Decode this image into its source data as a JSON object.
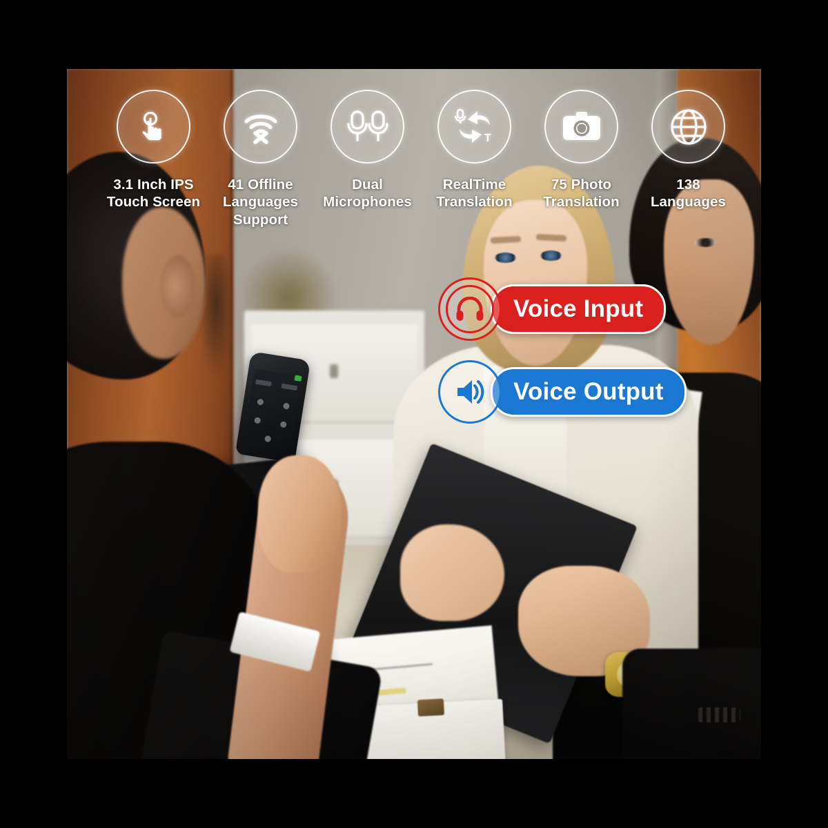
{
  "photo": {
    "scene_description": "Business meeting at a table with a woman holding a handheld voice translator device, another woman in a white blazer and a man in a black suit across the table",
    "frame_color": "#000000"
  },
  "features": [
    {
      "icon": "touch-screen-icon",
      "label": "3.1 Inch IPS\nTouch Screen"
    },
    {
      "icon": "wifi-offline-icon",
      "label": "41 Offline\nLanguages Support"
    },
    {
      "icon": "dual-microphone-icon",
      "label": "Dual\nMicrophones"
    },
    {
      "icon": "realtime-translation-icon",
      "label": "RealTime\nTranslation"
    },
    {
      "icon": "camera-icon",
      "label": "75 Photo\nTranslation"
    },
    {
      "icon": "globe-icon",
      "label": "138\nLanguages"
    }
  ],
  "badges": [
    {
      "icon": "headphones-icon",
      "label": "Voice Input",
      "color": "#D9201C"
    },
    {
      "icon": "speaker-icon",
      "label": "Voice Output",
      "color": "#1A78D2"
    }
  ],
  "colors": {
    "badge_red": "#D9201C",
    "badge_blue": "#1A78D2",
    "icon_outline": "#FFFFFF",
    "label_text": "#FFFFFF",
    "background": "#000000"
  }
}
